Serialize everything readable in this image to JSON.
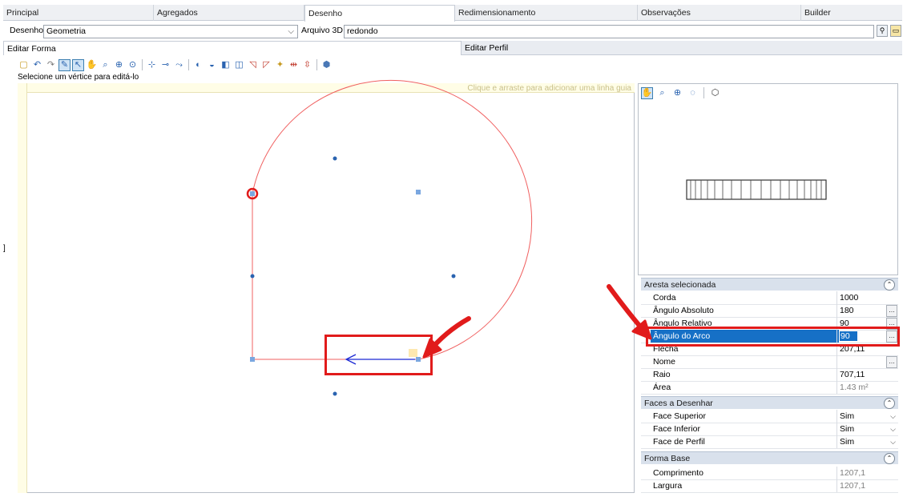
{
  "top_tabs": [
    {
      "label": "Principal",
      "active": false
    },
    {
      "label": "Agregados",
      "active": false
    },
    {
      "label": "Desenho",
      "active": true
    },
    {
      "label": "Redimensionamento",
      "active": false
    },
    {
      "label": "Observações",
      "active": false
    },
    {
      "label": "Builder",
      "active": false
    }
  ],
  "selector": {
    "desenho_label": "Desenho",
    "desenho_value": "Geometria",
    "arquivo_label": "Arquivo 3D",
    "arquivo_value": "redondo"
  },
  "sub_tabs": [
    {
      "label": "Editar Forma",
      "active": true
    },
    {
      "label": "Editar Perfil",
      "active": false
    }
  ],
  "hint": "Selecione um vértice para editá-lo",
  "guide_hint": "Clique e arraste para adicionar uma linha guia",
  "properties": {
    "aresta": {
      "title": "Aresta selecionada",
      "rows": [
        {
          "k": "Corda",
          "v": "1000"
        },
        {
          "k": "Ângulo Absoluto",
          "v": "180"
        },
        {
          "k": "Ângulo Relativo",
          "v": "90"
        },
        {
          "k": "Ângulo do Arco",
          "v": "90"
        },
        {
          "k": "Flecha",
          "v": "207,11"
        },
        {
          "k": "Nome",
          "v": ""
        },
        {
          "k": "Raio",
          "v": "707,11"
        },
        {
          "k": "Área",
          "v": "1.43 m²"
        }
      ]
    },
    "faces": {
      "title": "Faces a Desenhar",
      "rows": [
        {
          "k": "Face Superior",
          "v": "Sim"
        },
        {
          "k": "Face Inferior",
          "v": "Sim"
        },
        {
          "k": "Face de Perfil",
          "v": "Sim"
        }
      ]
    },
    "forma": {
      "title": "Forma Base",
      "rows": [
        {
          "k": "Comprimento",
          "v": "1207,1"
        },
        {
          "k": "Largura",
          "v": "1207,1"
        }
      ]
    }
  },
  "colors": {
    "accent": "#1670c6",
    "annotation": "#e11b1b",
    "curve": "#f06060"
  }
}
